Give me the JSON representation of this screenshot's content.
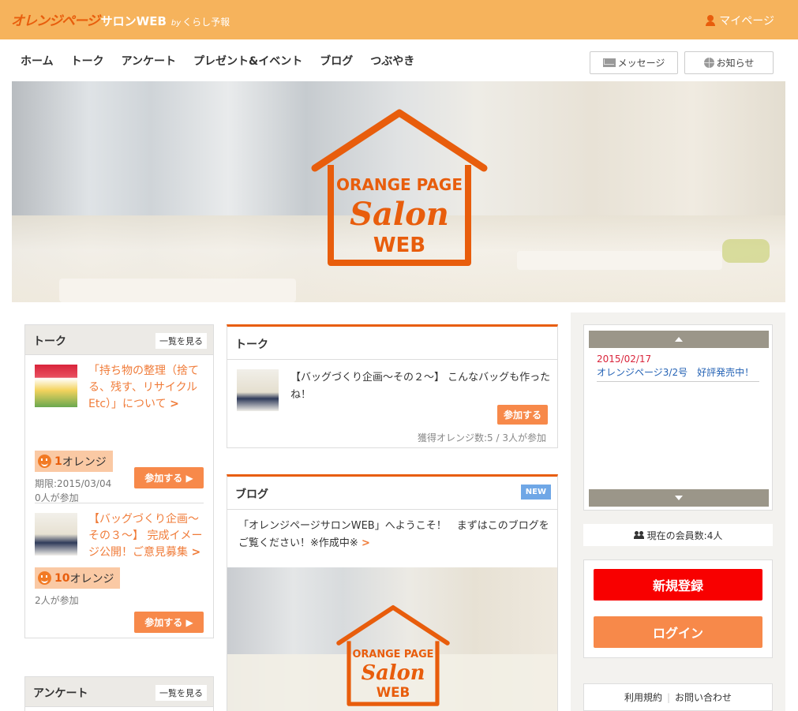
{
  "header": {
    "logo_main": "オレンジページ",
    "logo_sub": "サロンWEB",
    "logo_by": "by",
    "logo_by_name": "くらし予報",
    "mypage_label": "マイページ"
  },
  "nav": {
    "items": [
      "ホーム",
      "トーク",
      "アンケート",
      "プレゼント&イベント",
      "ブログ",
      "つぶやき"
    ],
    "message_label": "メッセージ",
    "notice_label": "お知らせ"
  },
  "hero": {
    "logo_line1": "ORANGE PAGE",
    "logo_line2": "Salon",
    "logo_line3": "WEB"
  },
  "left": {
    "talk": {
      "title": "トーク",
      "see_all": "一覧を見る",
      "items": [
        {
          "title": "「持ち物の整理（捨てる、残す、リサイクル Etc）」について",
          "arrow": ">",
          "orange_num": "1",
          "orange_unit": "オレンジ",
          "deadline": "期限:2015/03/04",
          "participants": "0人が参加",
          "join_label": "参加する ▶"
        },
        {
          "title": "【バッグづくり企画〜その３〜】 完成イメージ公開！ご意見募集",
          "arrow": ">",
          "orange_num": "10",
          "orange_unit": "オレンジ",
          "participants": "2人が参加",
          "join_label": "参加する ▶"
        }
      ]
    },
    "survey": {
      "title": "アンケート",
      "see_all": "一覧を見る"
    }
  },
  "center": {
    "talk": {
      "title": "トーク",
      "text": "【バッグづくり企画〜その２〜】 こんなバッグも作ったね！",
      "join_label": "参加する",
      "meta": "獲得オレンジ数:5 / 3人が参加"
    },
    "blog": {
      "title": "ブログ",
      "badge": "NEW",
      "text": "「オレンジページサロンWEB」へようこそ！　まずはこのブログをご覧ください！※作成中※",
      "arrow": ">"
    }
  },
  "right": {
    "news": {
      "date": "2015/02/17",
      "title": "オレンジページ3/2号　好評発売中！"
    },
    "members": "現在の会員数:4人",
    "register_label": "新規登録",
    "login_label": "ログイン",
    "footer_links": [
      "利用規約",
      "お問い合わせ"
    ]
  },
  "colors": {
    "header_bg": "#f6b35c",
    "accent_orange": "#e85d0c",
    "button_orange": "#f7894a",
    "register_red": "#f80000",
    "new_badge_blue": "#6fa7e6"
  }
}
